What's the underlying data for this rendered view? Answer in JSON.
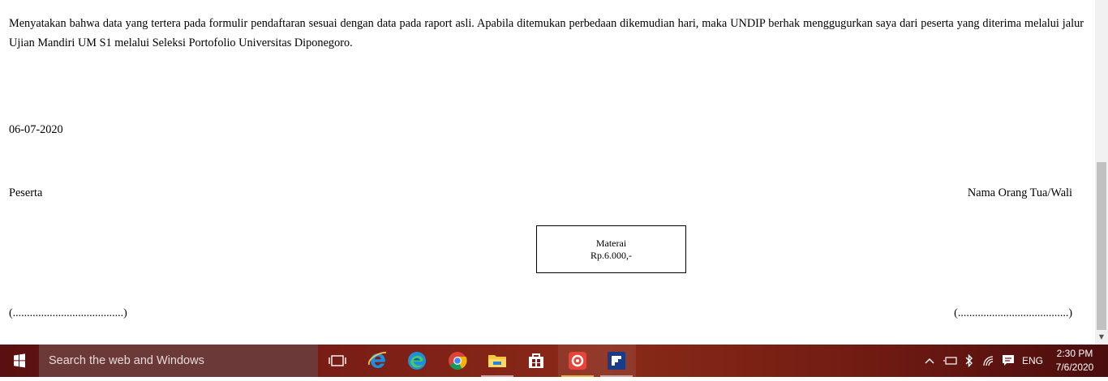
{
  "document": {
    "statement": "Menyatakan bahwa data yang tertera pada formulir pendaftaran sesuai dengan data pada raport asli. Apabila ditemukan perbedaan dikemudian hari, maka UNDIP berhak menggugurkan saya dari peserta yang diterima melalui jalur Ujian Mandiri UM S1 melalui Seleksi Portofolio Universitas Diponegoro.",
    "date": "06-07-2020",
    "participant_label": "Peserta",
    "guardian_label": "Nama Orang Tua/Wali",
    "stamp": {
      "line1": "Materai",
      "line2": "Rp.6.000,-"
    },
    "signature_left": "(.......................................)",
    "signature_right": "(.......................................)"
  },
  "taskbar": {
    "search_placeholder": "Search the web and Windows",
    "apps": [
      "task-view",
      "internet-explorer",
      "edge",
      "chrome",
      "file-explorer",
      "store",
      "snagit",
      "flipboard"
    ],
    "tray": {
      "language": "ENG",
      "time": "2:30 PM",
      "date": "7/6/2020"
    },
    "colors": {
      "background": "#7a1d16",
      "search": "#6b3a38"
    }
  }
}
